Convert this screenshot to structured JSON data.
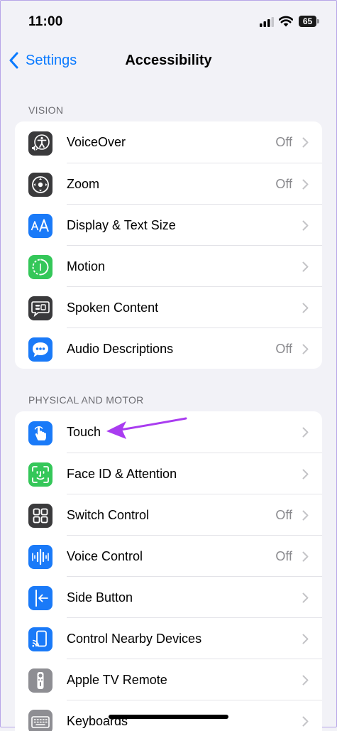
{
  "status_bar": {
    "time": "11:00",
    "battery": "65"
  },
  "nav": {
    "back_label": "Settings",
    "title": "Accessibility"
  },
  "sections": [
    {
      "header": "VISION",
      "items": [
        {
          "label": "VoiceOver",
          "value": "Off",
          "icon": "voiceover-icon",
          "icon_color": "#3a3a3c"
        },
        {
          "label": "Zoom",
          "value": "Off",
          "icon": "zoom-icon",
          "icon_color": "#3a3a3c"
        },
        {
          "label": "Display & Text Size",
          "value": "",
          "icon": "text-size-icon",
          "icon_color": "#1a7af8"
        },
        {
          "label": "Motion",
          "value": "",
          "icon": "motion-icon",
          "icon_color": "#34c759"
        },
        {
          "label": "Spoken Content",
          "value": "",
          "icon": "spoken-content-icon",
          "icon_color": "#3a3a3c"
        },
        {
          "label": "Audio Descriptions",
          "value": "Off",
          "icon": "audio-descriptions-icon",
          "icon_color": "#1a7af8"
        }
      ]
    },
    {
      "header": "PHYSICAL AND MOTOR",
      "items": [
        {
          "label": "Touch",
          "value": "",
          "icon": "touch-icon",
          "icon_color": "#1a7af8"
        },
        {
          "label": "Face ID & Attention",
          "value": "",
          "icon": "face-id-icon",
          "icon_color": "#34c759"
        },
        {
          "label": "Switch Control",
          "value": "Off",
          "icon": "switch-control-icon",
          "icon_color": "#3a3a3c"
        },
        {
          "label": "Voice Control",
          "value": "Off",
          "icon": "voice-control-icon",
          "icon_color": "#1a7af8"
        },
        {
          "label": "Side Button",
          "value": "",
          "icon": "side-button-icon",
          "icon_color": "#1a7af8"
        },
        {
          "label": "Control Nearby Devices",
          "value": "",
          "icon": "nearby-devices-icon",
          "icon_color": "#1a7af8"
        },
        {
          "label": "Apple TV Remote",
          "value": "",
          "icon": "tv-remote-icon",
          "icon_color": "#8e8e93"
        },
        {
          "label": "Keyboards",
          "value": "",
          "icon": "keyboard-icon",
          "icon_color": "#8e8e93"
        }
      ]
    }
  ],
  "colors": {
    "accent": "#0a7aff",
    "annotation_arrow": "#a93cf0"
  }
}
